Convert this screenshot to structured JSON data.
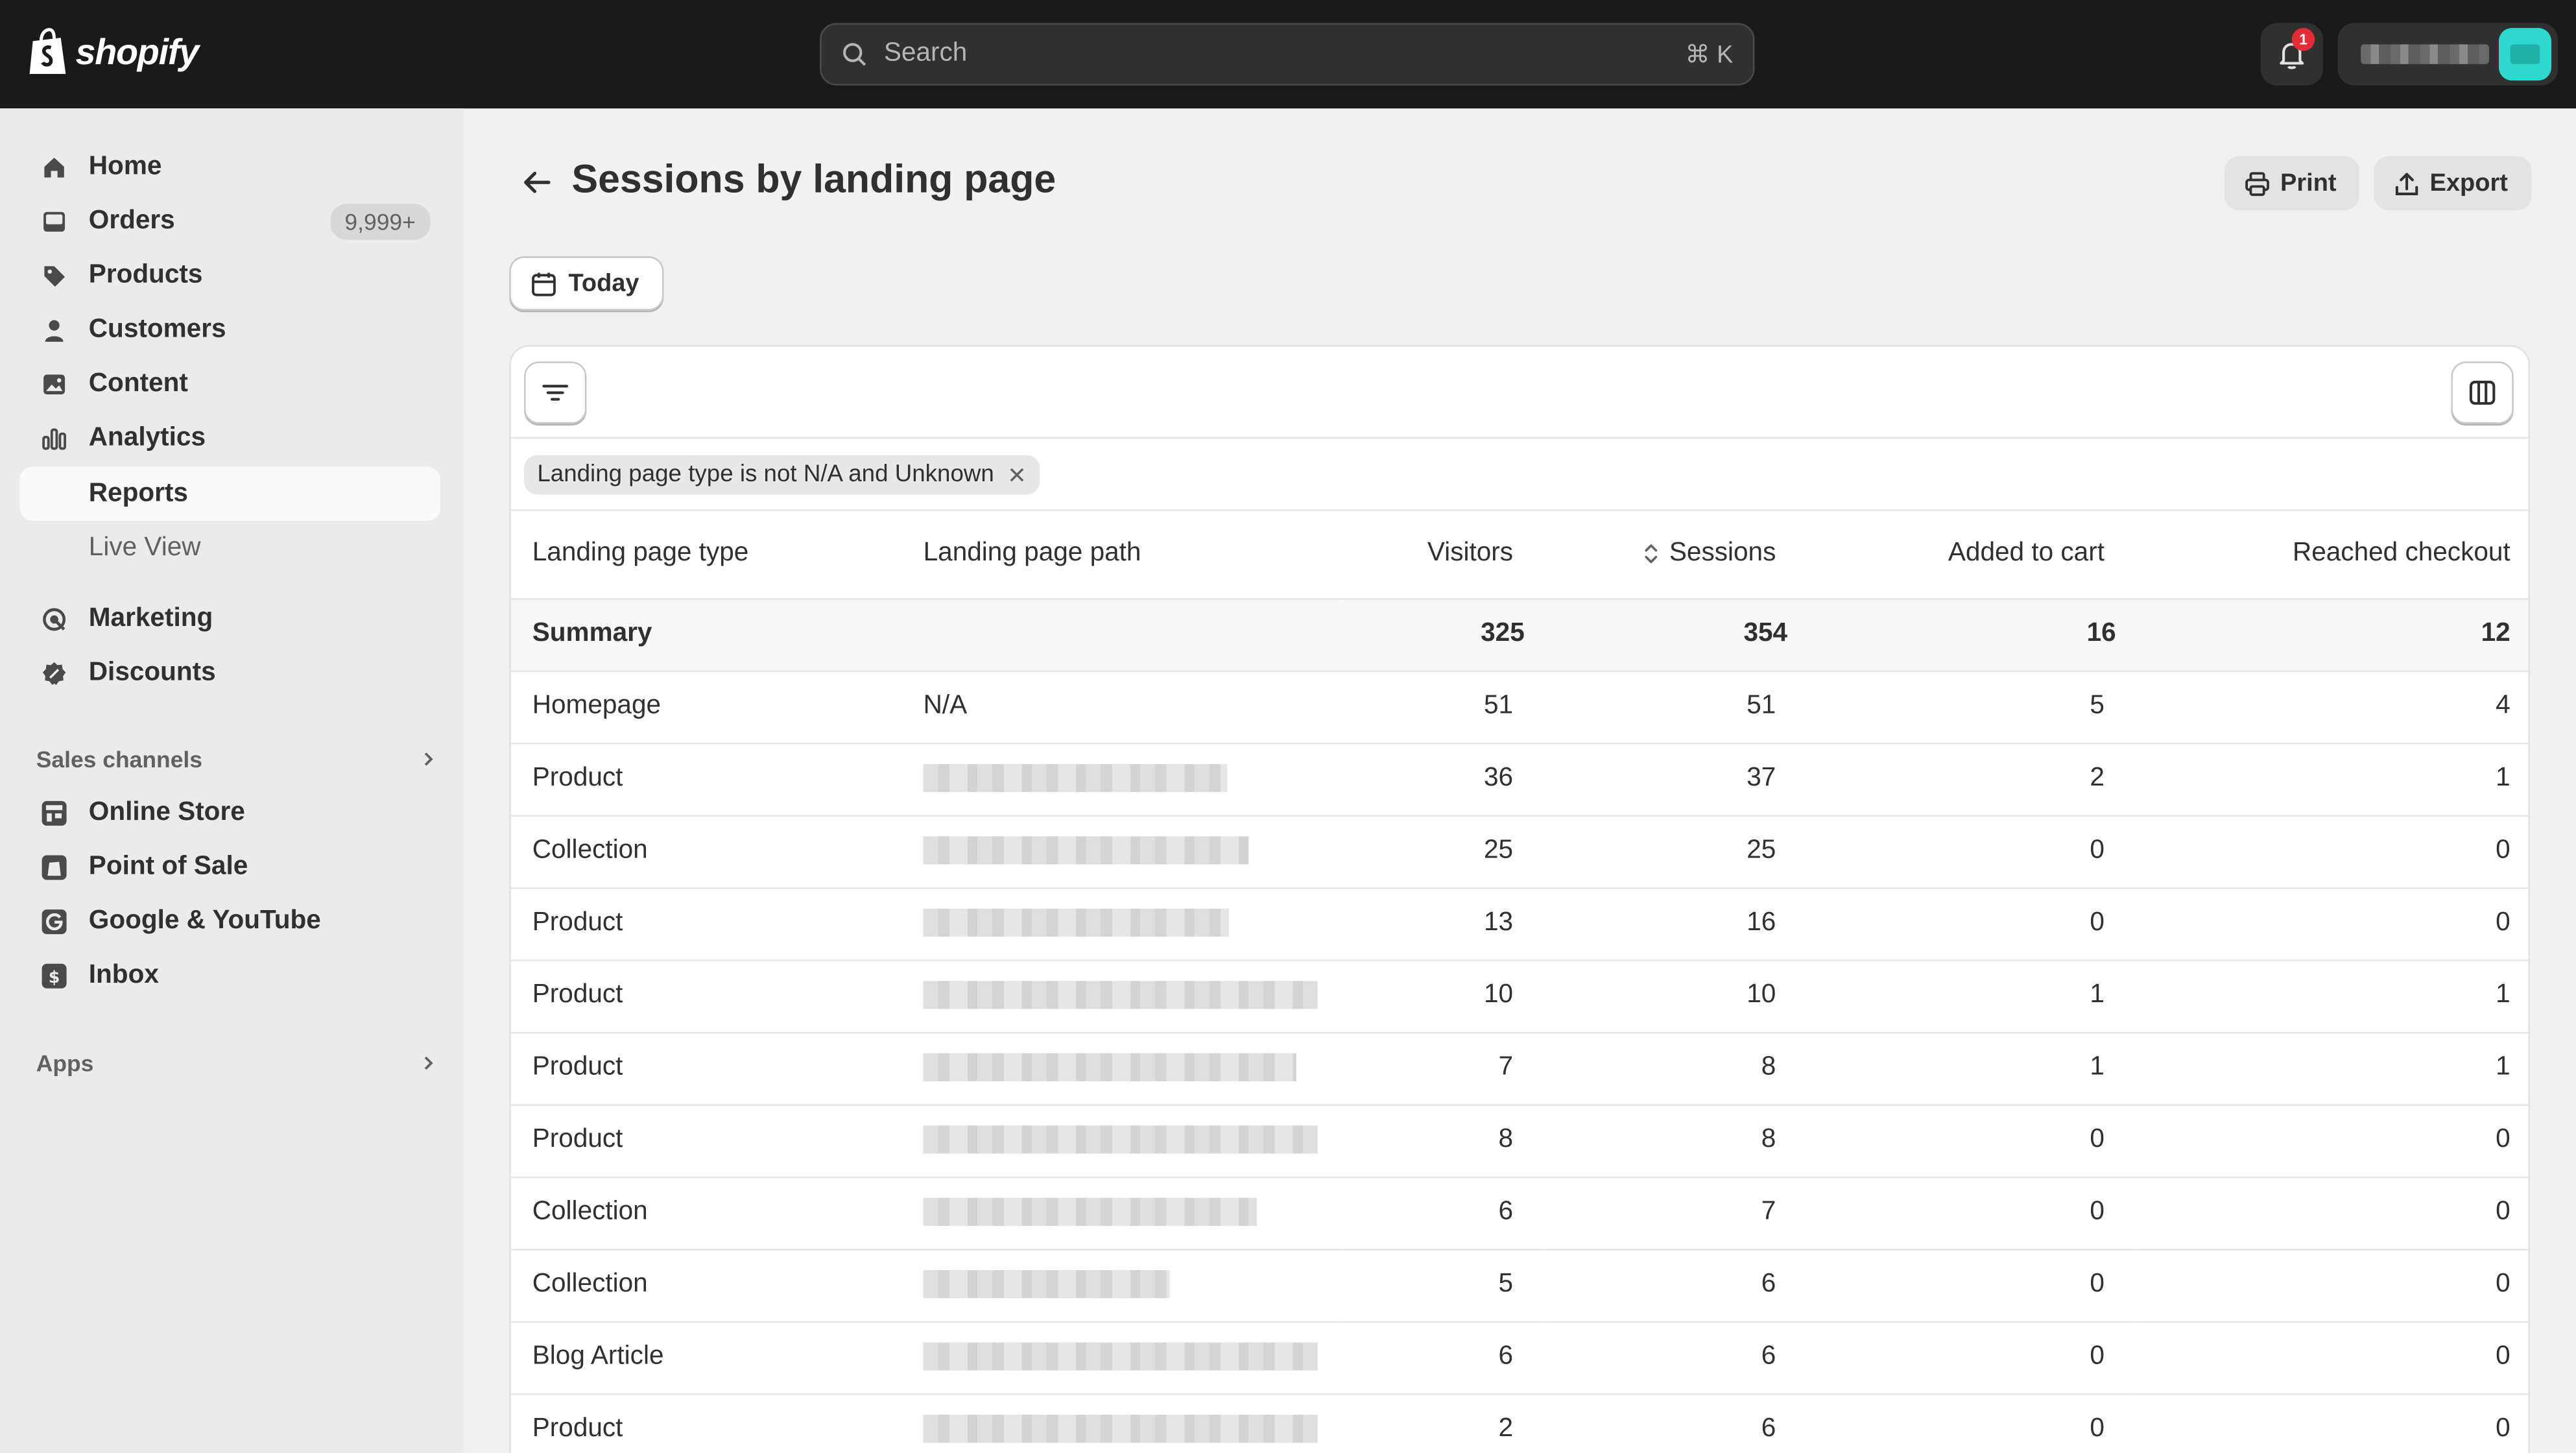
{
  "app": {
    "brand": "shopify",
    "accent": "#1a1a1a"
  },
  "search": {
    "placeholder": "Search",
    "shortcut": "⌘ K"
  },
  "notifications": {
    "count": "1"
  },
  "sidebar": {
    "items": [
      {
        "label": "Home",
        "icon": "home-icon"
      },
      {
        "label": "Orders",
        "icon": "orders-icon",
        "badge": "9,999+"
      },
      {
        "label": "Products",
        "icon": "tag-icon"
      },
      {
        "label": "Customers",
        "icon": "person-icon"
      },
      {
        "label": "Content",
        "icon": "image-icon"
      },
      {
        "label": "Analytics",
        "icon": "bar-chart-icon"
      },
      {
        "label": "Reports"
      },
      {
        "label": "Live View"
      },
      {
        "label": "Marketing",
        "icon": "target-icon"
      },
      {
        "label": "Discounts",
        "icon": "discount-icon"
      }
    ],
    "sales_channels_label": "Sales channels",
    "channels": [
      {
        "label": "Online Store",
        "icon": "store-icon"
      },
      {
        "label": "Point of Sale",
        "icon": "pos-icon"
      },
      {
        "label": "Google & YouTube",
        "icon": "google-icon"
      },
      {
        "label": "Inbox",
        "icon": "inbox-icon"
      }
    ],
    "apps_label": "Apps"
  },
  "page": {
    "title": "Sessions by landing page",
    "print_label": "Print",
    "export_label": "Export",
    "date_label": "Today",
    "filter_chip": "Landing page type is not N/A and Unknown"
  },
  "table": {
    "headers": [
      "Landing page type",
      "Landing page path",
      "Visitors",
      "Sessions",
      "Added to cart",
      "Reached checkout"
    ],
    "summary": {
      "label": "Summary",
      "visitors": "325",
      "sessions": "354",
      "added_to_cart": "16",
      "reached_checkout": "12"
    },
    "rows": [
      {
        "type": "Homepage",
        "path": "N/A",
        "visitors": "51",
        "sessions": "51",
        "added_to_cart": "5",
        "reached_checkout": "4"
      },
      {
        "type": "Product",
        "path": "",
        "visitors": "36",
        "sessions": "37",
        "added_to_cart": "2",
        "reached_checkout": "1"
      },
      {
        "type": "Collection",
        "path": "",
        "visitors": "25",
        "sessions": "25",
        "added_to_cart": "0",
        "reached_checkout": "0"
      },
      {
        "type": "Product",
        "path": "",
        "visitors": "13",
        "sessions": "16",
        "added_to_cart": "0",
        "reached_checkout": "0"
      },
      {
        "type": "Product",
        "path": "",
        "visitors": "10",
        "sessions": "10",
        "added_to_cart": "1",
        "reached_checkout": "1"
      },
      {
        "type": "Product",
        "path": "",
        "visitors": "7",
        "sessions": "8",
        "added_to_cart": "1",
        "reached_checkout": "1"
      },
      {
        "type": "Product",
        "path": "",
        "visitors": "8",
        "sessions": "8",
        "added_to_cart": "0",
        "reached_checkout": "0"
      },
      {
        "type": "Collection",
        "path": "",
        "visitors": "6",
        "sessions": "7",
        "added_to_cart": "0",
        "reached_checkout": "0"
      },
      {
        "type": "Collection",
        "path": "",
        "visitors": "5",
        "sessions": "6",
        "added_to_cart": "0",
        "reached_checkout": "0"
      },
      {
        "type": "Blog Article",
        "path": "",
        "visitors": "6",
        "sessions": "6",
        "added_to_cart": "0",
        "reached_checkout": "0"
      },
      {
        "type": "Product",
        "path": "",
        "visitors": "2",
        "sessions": "6",
        "added_to_cart": "0",
        "reached_checkout": "0"
      }
    ]
  }
}
